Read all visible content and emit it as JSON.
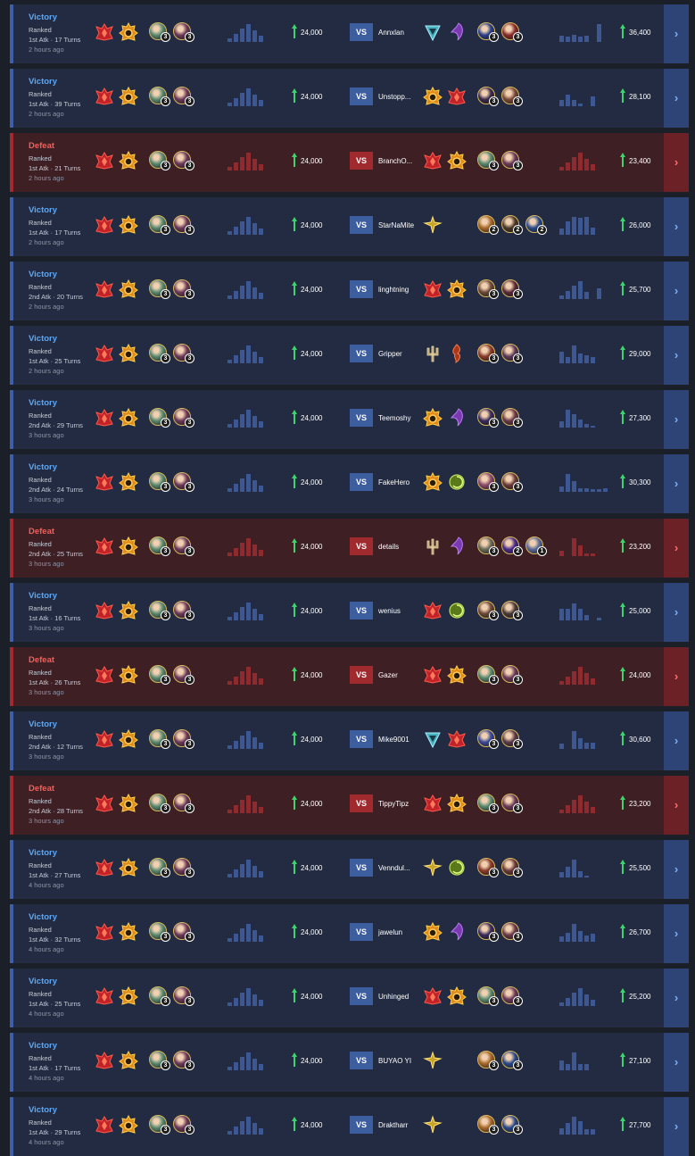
{
  "vs_label": "VS",
  "go_glyph": "›",
  "colors": {
    "victory": "#5fa8f5",
    "defeat": "#f0605a",
    "win_row": "#222b41",
    "loss_row": "#3e1f24",
    "trophy_arrow": "#3fd36b"
  },
  "matches": [
    {
      "result": "Victory",
      "outcome": "win",
      "mode": "Ranked",
      "attack": "1st Atk",
      "turns": "17 Turns",
      "time": "2 hours ago",
      "my_trophies": "24,000",
      "opponent": "Annxlan",
      "opp_trophies": "36,400",
      "my_icons": [
        "ruby-crest",
        "sun-crest"
      ],
      "my_champs": [
        {
          "color": "#5a8a72",
          "count": "3"
        },
        {
          "color": "#6b3a5a",
          "count": "3"
        }
      ],
      "opp_icons": [
        "ice-crest",
        "void-crest"
      ],
      "opp_champs": [
        {
          "color": "#2a3f8a",
          "count": "3"
        },
        {
          "color": "#8a2b2b",
          "count": "3"
        }
      ],
      "my_bars": [
        0.2,
        0.4,
        0.7,
        0.9,
        0.6,
        0.3
      ],
      "opp_bars": [
        0.3,
        0.25,
        0.35,
        0.25,
        0.3,
        0,
        0.9
      ]
    },
    {
      "result": "Victory",
      "outcome": "win",
      "mode": "Ranked",
      "attack": "1st Atk",
      "turns": "39 Turns",
      "time": "2 hours ago",
      "my_trophies": "24,000",
      "opponent": "Unstopp...",
      "opp_trophies": "28,100",
      "my_icons": [
        "ruby-crest",
        "sun-crest"
      ],
      "my_champs": [
        {
          "color": "#5a8a72",
          "count": "3"
        },
        {
          "color": "#6b3a5a",
          "count": "3"
        }
      ],
      "opp_icons": [
        "sun-crest",
        "ruby-crest"
      ],
      "opp_champs": [
        {
          "color": "#3a2a4a",
          "count": "3"
        },
        {
          "color": "#7a4a3a",
          "count": "3"
        }
      ],
      "my_bars": [
        0.2,
        0.4,
        0.7,
        0.9,
        0.6,
        0.3
      ],
      "opp_bars": [
        0.3,
        0.6,
        0.3,
        0.15,
        0,
        0.5
      ]
    },
    {
      "result": "Defeat",
      "outcome": "loss",
      "mode": "Ranked",
      "attack": "1st Atk",
      "turns": "21 Turns",
      "time": "2 hours ago",
      "my_trophies": "24,000",
      "opponent": "BranchO...",
      "opp_trophies": "23,400",
      "my_icons": [
        "ruby-crest",
        "sun-crest"
      ],
      "my_champs": [
        {
          "color": "#5a8a72",
          "count": "3"
        },
        {
          "color": "#6b3a5a",
          "count": "3"
        }
      ],
      "opp_icons": [
        "ruby-crest",
        "sun-crest"
      ],
      "opp_champs": [
        {
          "color": "#5a8a72",
          "count": "3"
        },
        {
          "color": "#6b3a5a",
          "count": "3"
        }
      ],
      "my_bars": [
        0.2,
        0.4,
        0.7,
        0.9,
        0.6,
        0.3
      ],
      "opp_bars": [
        0.2,
        0.4,
        0.7,
        0.9,
        0.6,
        0.3
      ]
    },
    {
      "result": "Victory",
      "outcome": "win",
      "mode": "Ranked",
      "attack": "1st Atk",
      "turns": "17 Turns",
      "time": "2 hours ago",
      "my_trophies": "24,000",
      "opponent": "StarNaMite",
      "opp_trophies": "26,000",
      "my_icons": [
        "ruby-crest",
        "sun-crest"
      ],
      "my_champs": [
        {
          "color": "#5a8a72",
          "count": "3"
        },
        {
          "color": "#6b3a5a",
          "count": "3"
        }
      ],
      "opp_icons": [
        "gold-crest"
      ],
      "opp_champs": [
        {
          "color": "#a86a2a",
          "count": "2"
        },
        {
          "color": "#4a3a2a",
          "count": "2"
        },
        {
          "color": "#2a4a8a",
          "count": "2"
        }
      ],
      "my_bars": [
        0.2,
        0.4,
        0.7,
        0.9,
        0.6,
        0.3
      ],
      "opp_bars": [
        0.3,
        0.7,
        0.9,
        0.85,
        0.9,
        0.35
      ]
    },
    {
      "result": "Victory",
      "outcome": "win",
      "mode": "Ranked",
      "attack": "2nd Atk",
      "turns": "20 Turns",
      "time": "2 hours ago",
      "my_trophies": "24,000",
      "opponent": "linghtning",
      "opp_trophies": "25,700",
      "my_icons": [
        "ruby-crest",
        "sun-crest"
      ],
      "my_champs": [
        {
          "color": "#5a8a72",
          "count": "3"
        },
        {
          "color": "#6b3a5a",
          "count": "3"
        }
      ],
      "opp_icons": [
        "ruby-crest",
        "sun-crest"
      ],
      "opp_champs": [
        {
          "color": "#6a4a3a",
          "count": "3"
        },
        {
          "color": "#5a2a3a",
          "count": "3"
        }
      ],
      "my_bars": [
        0.2,
        0.4,
        0.7,
        0.9,
        0.6,
        0.3
      ],
      "opp_bars": [
        0.2,
        0.4,
        0.7,
        0.9,
        0.35,
        0,
        0.55
      ]
    },
    {
      "result": "Victory",
      "outcome": "win",
      "mode": "Ranked",
      "attack": "1st Atk",
      "turns": "25 Turns",
      "time": "2 hours ago",
      "my_trophies": "24,000",
      "opponent": "Gripper",
      "opp_trophies": "29,000",
      "my_icons": [
        "ruby-crest",
        "sun-crest"
      ],
      "my_champs": [
        {
          "color": "#5a8a72",
          "count": "3"
        },
        {
          "color": "#6b3a5a",
          "count": "3"
        }
      ],
      "opp_icons": [
        "trident-crest",
        "ember-crest"
      ],
      "opp_champs": [
        {
          "color": "#8a3a2a",
          "count": "3"
        },
        {
          "color": "#5a3a5a",
          "count": "3"
        }
      ],
      "my_bars": [
        0.2,
        0.4,
        0.7,
        0.9,
        0.6,
        0.3
      ],
      "opp_bars": [
        0.6,
        0.3,
        0.9,
        0.5,
        0.4,
        0.3
      ]
    },
    {
      "result": "Victory",
      "outcome": "win",
      "mode": "Ranked",
      "attack": "2nd Atk",
      "turns": "29 Turns",
      "time": "3 hours ago",
      "my_trophies": "24,000",
      "opponent": "Teemoshy",
      "opp_trophies": "27,300",
      "my_icons": [
        "ruby-crest",
        "sun-crest"
      ],
      "my_champs": [
        {
          "color": "#5a8a72",
          "count": "3"
        },
        {
          "color": "#6b3a5a",
          "count": "3"
        }
      ],
      "opp_icons": [
        "sun-crest",
        "void-crest"
      ],
      "opp_champs": [
        {
          "color": "#3a2a5a",
          "count": "3"
        },
        {
          "color": "#6a3a4a",
          "count": "3"
        }
      ],
      "my_bars": [
        0.2,
        0.4,
        0.7,
        0.9,
        0.6,
        0.3
      ],
      "opp_bars": [
        0.3,
        0.9,
        0.7,
        0.4,
        0.2,
        0.1
      ]
    },
    {
      "result": "Victory",
      "outcome": "win",
      "mode": "Ranked",
      "attack": "2nd Atk",
      "turns": "24 Turns",
      "time": "3 hours ago",
      "my_trophies": "24,000",
      "opponent": "FakeHero",
      "opp_trophies": "30,300",
      "my_icons": [
        "ruby-crest",
        "sun-crest"
      ],
      "my_champs": [
        {
          "color": "#5a8a72",
          "count": "3"
        },
        {
          "color": "#6b3a5a",
          "count": "3"
        }
      ],
      "opp_icons": [
        "sun-crest",
        "jade-crest"
      ],
      "opp_champs": [
        {
          "color": "#8a4a6a",
          "count": "3"
        },
        {
          "color": "#6a3a3a",
          "count": "3"
        }
      ],
      "my_bars": [
        0.2,
        0.4,
        0.7,
        0.9,
        0.6,
        0.3
      ],
      "opp_bars": [
        0.25,
        0.9,
        0.55,
        0.2,
        0.2,
        0.15,
        0.15,
        0.2
      ]
    },
    {
      "result": "Defeat",
      "outcome": "loss",
      "mode": "Ranked",
      "attack": "2nd Atk",
      "turns": "25 Turns",
      "time": "3 hours ago",
      "my_trophies": "24,000",
      "opponent": "details",
      "opp_trophies": "23,200",
      "my_icons": [
        "ruby-crest",
        "sun-crest"
      ],
      "my_champs": [
        {
          "color": "#5a8a72",
          "count": "3"
        },
        {
          "color": "#6b3a5a",
          "count": "3"
        }
      ],
      "opp_icons": [
        "trident-crest",
        "void-crest"
      ],
      "opp_champs": [
        {
          "color": "#6a6a5a",
          "count": "3"
        },
        {
          "color": "#4a2a8a",
          "count": "2"
        },
        {
          "color": "#5a6a9a",
          "count": "1"
        }
      ],
      "my_bars": [
        0.2,
        0.4,
        0.7,
        0.9,
        0.6,
        0.3
      ],
      "opp_bars": [
        0.25,
        0,
        0.9,
        0.55,
        0.15,
        0.15
      ]
    },
    {
      "result": "Victory",
      "outcome": "win",
      "mode": "Ranked",
      "attack": "1st Atk",
      "turns": "16 Turns",
      "time": "3 hours ago",
      "my_trophies": "24,000",
      "opponent": "wenius",
      "opp_trophies": "25,000",
      "my_icons": [
        "ruby-crest",
        "sun-crest"
      ],
      "my_champs": [
        {
          "color": "#5a8a72",
          "count": "3"
        },
        {
          "color": "#6b3a5a",
          "count": "3"
        }
      ],
      "opp_icons": [
        "ruby-crest",
        "jade-crest"
      ],
      "opp_champs": [
        {
          "color": "#6a4a3a",
          "count": "3"
        },
        {
          "color": "#4a3a3a",
          "count": "3"
        }
      ],
      "my_bars": [
        0.2,
        0.4,
        0.7,
        0.9,
        0.6,
        0.3
      ],
      "opp_bars": [
        0.6,
        0.6,
        0.85,
        0.6,
        0.25,
        0,
        0.15
      ]
    },
    {
      "result": "Defeat",
      "outcome": "loss",
      "mode": "Ranked",
      "attack": "1st Atk",
      "turns": "26 Turns",
      "time": "3 hours ago",
      "my_trophies": "24,000",
      "opponent": "Gazer",
      "opp_trophies": "24,000",
      "my_icons": [
        "ruby-crest",
        "sun-crest"
      ],
      "my_champs": [
        {
          "color": "#5a8a72",
          "count": "3"
        },
        {
          "color": "#6b3a5a",
          "count": "3"
        }
      ],
      "opp_icons": [
        "ruby-crest",
        "sun-crest"
      ],
      "opp_champs": [
        {
          "color": "#5a8a72",
          "count": "3"
        },
        {
          "color": "#6b3a5a",
          "count": "3"
        }
      ],
      "my_bars": [
        0.2,
        0.4,
        0.7,
        0.9,
        0.6,
        0.3
      ],
      "opp_bars": [
        0.2,
        0.4,
        0.7,
        0.9,
        0.6,
        0.3
      ]
    },
    {
      "result": "Victory",
      "outcome": "win",
      "mode": "Ranked",
      "attack": "2nd Atk",
      "turns": "12 Turns",
      "time": "3 hours ago",
      "my_trophies": "24,000",
      "opponent": "Mike9001",
      "opp_trophies": "30,600",
      "my_icons": [
        "ruby-crest",
        "sun-crest"
      ],
      "my_champs": [
        {
          "color": "#5a8a72",
          "count": "3"
        },
        {
          "color": "#6b3a5a",
          "count": "3"
        }
      ],
      "opp_icons": [
        "ice-crest",
        "ruby-crest"
      ],
      "opp_champs": [
        {
          "color": "#3a4a9a",
          "count": "3"
        },
        {
          "color": "#5a3a4a",
          "count": "3"
        }
      ],
      "my_bars": [
        0.2,
        0.4,
        0.7,
        0.9,
        0.6,
        0.3
      ],
      "opp_bars": [
        0.25,
        0,
        0.9,
        0.55,
        0.3,
        0.3
      ]
    },
    {
      "result": "Defeat",
      "outcome": "loss",
      "mode": "Ranked",
      "attack": "2nd Atk",
      "turns": "28 Turns",
      "time": "3 hours ago",
      "my_trophies": "24,000",
      "opponent": "TippyTipz",
      "opp_trophies": "23,200",
      "my_icons": [
        "ruby-crest",
        "sun-crest"
      ],
      "my_champs": [
        {
          "color": "#5a8a72",
          "count": "3"
        },
        {
          "color": "#6b3a5a",
          "count": "3"
        }
      ],
      "opp_icons": [
        "ruby-crest",
        "sun-crest"
      ],
      "opp_champs": [
        {
          "color": "#5a8a72",
          "count": "3"
        },
        {
          "color": "#6b3a5a",
          "count": "3"
        }
      ],
      "my_bars": [
        0.2,
        0.4,
        0.7,
        0.9,
        0.6,
        0.3
      ],
      "opp_bars": [
        0.2,
        0.4,
        0.7,
        0.9,
        0.6,
        0.3
      ]
    },
    {
      "result": "Victory",
      "outcome": "win",
      "mode": "Ranked",
      "attack": "1st Atk",
      "turns": "27 Turns",
      "time": "4 hours ago",
      "my_trophies": "24,000",
      "opponent": "Venndul...",
      "opp_trophies": "25,500",
      "my_icons": [
        "ruby-crest",
        "sun-crest"
      ],
      "my_champs": [
        {
          "color": "#5a8a72",
          "count": "3"
        },
        {
          "color": "#6b3a5a",
          "count": "3"
        }
      ],
      "opp_icons": [
        "gold-crest",
        "jade-crest"
      ],
      "opp_champs": [
        {
          "color": "#8a3a2a",
          "count": "3"
        },
        {
          "color": "#6a3a3a",
          "count": "3"
        }
      ],
      "my_bars": [
        0.2,
        0.4,
        0.7,
        0.9,
        0.6,
        0.3
      ],
      "opp_bars": [
        0.25,
        0.55,
        0.9,
        0.3,
        0.1
      ]
    },
    {
      "result": "Victory",
      "outcome": "win",
      "mode": "Ranked",
      "attack": "1st Atk",
      "turns": "32 Turns",
      "time": "4 hours ago",
      "my_trophies": "24,000",
      "opponent": "jawelun",
      "opp_trophies": "26,700",
      "my_icons": [
        "ruby-crest",
        "sun-crest"
      ],
      "my_champs": [
        {
          "color": "#5a8a72",
          "count": "3"
        },
        {
          "color": "#6b3a5a",
          "count": "3"
        }
      ],
      "opp_icons": [
        "sun-crest",
        "void-crest"
      ],
      "opp_champs": [
        {
          "color": "#3a2a5a",
          "count": "3"
        },
        {
          "color": "#6a3a4a",
          "count": "3"
        }
      ],
      "my_bars": [
        0.2,
        0.4,
        0.7,
        0.9,
        0.6,
        0.3
      ],
      "opp_bars": [
        0.25,
        0.45,
        0.9,
        0.55,
        0.3,
        0.4
      ]
    },
    {
      "result": "Victory",
      "outcome": "win",
      "mode": "Ranked",
      "attack": "1st Atk",
      "turns": "25 Turns",
      "time": "4 hours ago",
      "my_trophies": "24,000",
      "opponent": "Unhinged",
      "opp_trophies": "25,200",
      "my_icons": [
        "ruby-crest",
        "sun-crest"
      ],
      "my_champs": [
        {
          "color": "#5a8a72",
          "count": "3"
        },
        {
          "color": "#6b3a5a",
          "count": "3"
        }
      ],
      "opp_icons": [
        "ruby-crest",
        "sun-crest"
      ],
      "opp_champs": [
        {
          "color": "#5a8a72",
          "count": "3"
        },
        {
          "color": "#6b3a5a",
          "count": "3"
        }
      ],
      "my_bars": [
        0.2,
        0.4,
        0.7,
        0.9,
        0.6,
        0.3
      ],
      "opp_bars": [
        0.2,
        0.4,
        0.7,
        0.9,
        0.6,
        0.3
      ]
    },
    {
      "result": "Victory",
      "outcome": "win",
      "mode": "Ranked",
      "attack": "1st Atk",
      "turns": "17 Turns",
      "time": "4 hours ago",
      "my_trophies": "24,000",
      "opponent": "BUYAO YI",
      "opp_trophies": "27,100",
      "my_icons": [
        "ruby-crest",
        "sun-crest"
      ],
      "my_champs": [
        {
          "color": "#5a8a72",
          "count": "3"
        },
        {
          "color": "#6b3a5a",
          "count": "3"
        }
      ],
      "opp_icons": [
        "gold-crest"
      ],
      "opp_champs": [
        {
          "color": "#a86a2a",
          "count": "3"
        },
        {
          "color": "#2a4a8a",
          "count": "3"
        }
      ],
      "my_bars": [
        0.2,
        0.4,
        0.7,
        0.9,
        0.6,
        0.3
      ],
      "opp_bars": [
        0.5,
        0.3,
        0.9,
        0.3,
        0.3
      ]
    },
    {
      "result": "Victory",
      "outcome": "win",
      "mode": "Ranked",
      "attack": "1st Atk",
      "turns": "29 Turns",
      "time": "4 hours ago",
      "my_trophies": "24,000",
      "opponent": "Draktharr",
      "opp_trophies": "27,700",
      "my_icons": [
        "ruby-crest",
        "sun-crest"
      ],
      "my_champs": [
        {
          "color": "#5a8a72",
          "count": "3"
        },
        {
          "color": "#6b3a5a",
          "count": "3"
        }
      ],
      "opp_icons": [
        "gold-crest"
      ],
      "opp_champs": [
        {
          "color": "#a86a2a",
          "count": "3"
        },
        {
          "color": "#2a4a8a",
          "count": "3"
        }
      ],
      "my_bars": [
        0.2,
        0.4,
        0.7,
        0.9,
        0.6,
        0.3
      ],
      "opp_bars": [
        0.3,
        0.6,
        0.9,
        0.7,
        0.25,
        0.25
      ]
    }
  ]
}
